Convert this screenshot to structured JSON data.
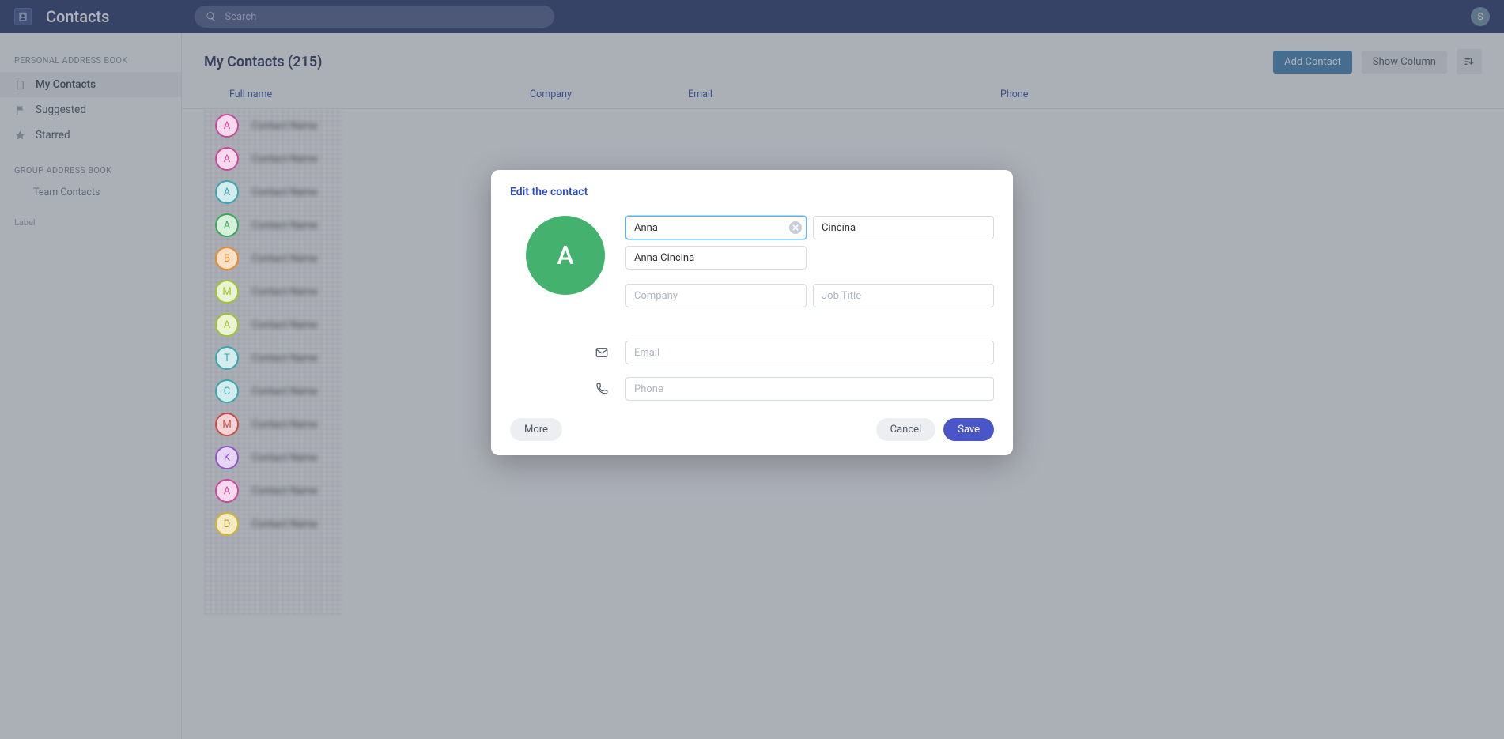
{
  "app": {
    "title": "Contacts"
  },
  "search": {
    "placeholder": "Search"
  },
  "user": {
    "initial": "S"
  },
  "sidebar": {
    "section1_label": "PERSONAL ADDRESS BOOK",
    "items": [
      {
        "label": "My Contacts"
      },
      {
        "label": "Suggested"
      },
      {
        "label": "Starred"
      }
    ],
    "section2_label": "GROUP ADDRESS BOOK",
    "group_items": [
      {
        "label": "Team Contacts"
      }
    ],
    "footer_label": "Label"
  },
  "content": {
    "title": "My Contacts (215)",
    "add_btn": "Add Contact",
    "show_col_btn": "Show Column",
    "columns": {
      "name": "Full name",
      "company": "Company",
      "email": "Email",
      "phone": "Phone"
    }
  },
  "modal": {
    "title": "Edit the contact",
    "avatar_letter": "A",
    "first_name": "Anna",
    "last_name": "Cincina",
    "display_name": "Anna Cincina",
    "company": "",
    "job_title": "",
    "email": "",
    "phone": "",
    "placeholders": {
      "company": "Company",
      "job_title": "Job Title",
      "email": "Email",
      "phone": "Phone"
    },
    "buttons": {
      "more": "More",
      "cancel": "Cancel",
      "save": "Save"
    }
  }
}
